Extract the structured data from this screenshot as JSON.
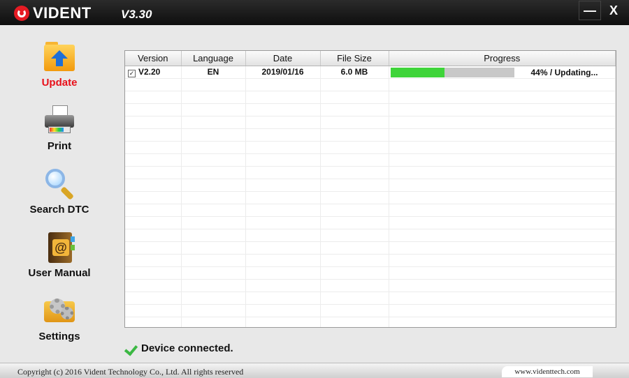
{
  "window": {
    "brand": "VIDENT",
    "version": "V3.30",
    "minimize_label": "—",
    "close_label": "X"
  },
  "sidebar": {
    "items": [
      {
        "label": "Update",
        "icon": "folder-update-icon",
        "active": true
      },
      {
        "label": "Print",
        "icon": "printer-icon",
        "active": false
      },
      {
        "label": "Search DTC",
        "icon": "magnifier-icon",
        "active": false
      },
      {
        "label": "User Manual",
        "icon": "address-book-icon",
        "active": false
      },
      {
        "label": "Settings",
        "icon": "gears-icon",
        "active": false
      }
    ]
  },
  "table": {
    "columns": [
      "Version",
      "Language",
      "Date",
      "File Size",
      "Progress"
    ],
    "rows": [
      {
        "checked": true,
        "version": "V2.20",
        "language": "EN",
        "date": "2019/01/16",
        "file_size": "6.0 MB",
        "progress": 44,
        "progress_text": "44% / Updating..."
      }
    ]
  },
  "status": {
    "text": "Device connected.",
    "icon": "checkmark-icon"
  },
  "footer": {
    "copyright": "Copyright (c) 2016 Vident Technology Co., Ltd. All rights reserved",
    "website": "www.videnttech.com"
  },
  "colors": {
    "accent_red": "#e8101a",
    "progress_green": "#3fd43a",
    "progress_track": "#c8c8c8"
  }
}
